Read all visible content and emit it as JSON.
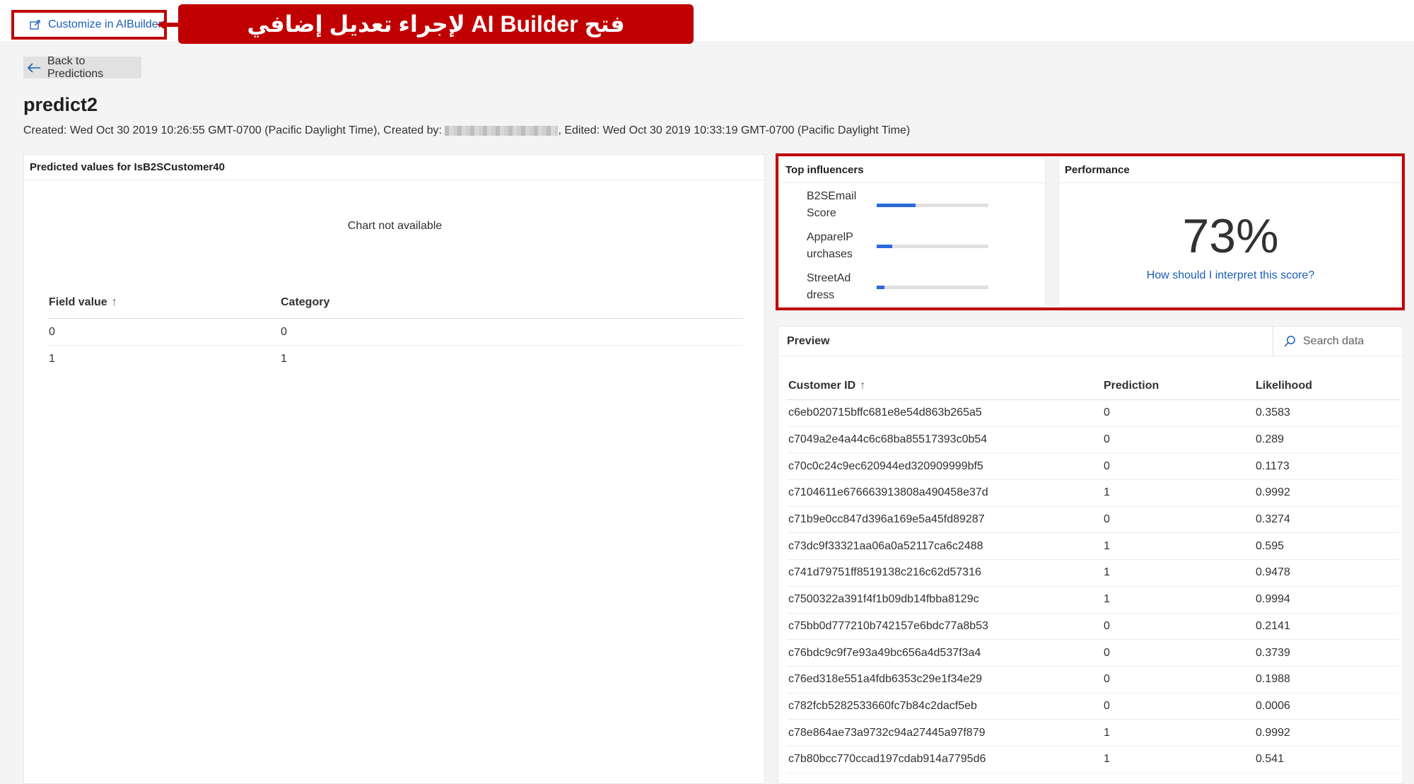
{
  "header": {
    "customize_label": "Customize in AIBuilder",
    "callout_text": "فتح AI Builder لإجراء تعديل إضافي"
  },
  "nav": {
    "back_label": "Back to Predictions"
  },
  "model": {
    "name": "predict2",
    "created": "Created: Wed Oct 30 2019 10:26:55 GMT-0700 (Pacific Daylight Time), Created by: ",
    "edited": ", Edited: Wed Oct 30 2019 10:33:19 GMT-0700 (Pacific Daylight Time)"
  },
  "predicted_values": {
    "title": "Predicted values for IsB2SCustomer40",
    "chart_message": "Chart not available",
    "columns": [
      "Field value",
      "Category"
    ],
    "sort_indicator": "↑",
    "rows": [
      {
        "field_value": "0",
        "category": "0"
      },
      {
        "field_value": "1",
        "category": "1"
      }
    ]
  },
  "top_influencers": {
    "title": "Top influencers",
    "items": [
      {
        "label": "B2SEmail Score",
        "level": 0.35
      },
      {
        "label": "ApparelP urchases",
        "level": 0.14
      },
      {
        "label": "StreetAd dress",
        "level": 0.07
      }
    ]
  },
  "performance": {
    "title": "Performance",
    "value": "73%",
    "link": "How should I interpret this score?"
  },
  "preview": {
    "title": "Preview",
    "search_placeholder": "Search data",
    "columns": [
      "Customer ID",
      "Prediction",
      "Likelihood"
    ],
    "sort_indicator": "↑",
    "rows": [
      {
        "id": "c6eb020715bffc681e8e54d863b265a5",
        "prediction": "0",
        "likelihood": "0.3583"
      },
      {
        "id": "c7049a2e4a44c6c68ba85517393c0b54",
        "prediction": "0",
        "likelihood": "0.289"
      },
      {
        "id": "c70c0c24c9ec620944ed320909999bf5",
        "prediction": "0",
        "likelihood": "0.1173"
      },
      {
        "id": "c7104611e676663913808a490458e37d",
        "prediction": "1",
        "likelihood": "0.9992"
      },
      {
        "id": "c71b9e0cc847d396a169e5a45fd89287",
        "prediction": "0",
        "likelihood": "0.3274"
      },
      {
        "id": "c73dc9f33321aa06a0a52117ca6c2488",
        "prediction": "1",
        "likelihood": "0.595"
      },
      {
        "id": "c741d79751ff8519138c216c62d57316",
        "prediction": "1",
        "likelihood": "0.9478"
      },
      {
        "id": "c7500322a391f4f1b09db14fbba8129c",
        "prediction": "1",
        "likelihood": "0.9994"
      },
      {
        "id": "c75bb0d777210b742157e6bdc77a8b53",
        "prediction": "0",
        "likelihood": "0.2141"
      },
      {
        "id": "c76bdc9c9f7e93a49bc656a4d537f3a4",
        "prediction": "0",
        "likelihood": "0.3739"
      },
      {
        "id": "c76ed318e551a4fdb6353c29e1f34e29",
        "prediction": "0",
        "likelihood": "0.1988"
      },
      {
        "id": "c782fcb5282533660fc7b84c2dacf5eb",
        "prediction": "0",
        "likelihood": "0.0006"
      },
      {
        "id": "c78e864ae73a9732c94a27445a97f879",
        "prediction": "1",
        "likelihood": "0.9992"
      },
      {
        "id": "c7b80bcc770ccad197cdab914a7795d6",
        "prediction": "1",
        "likelihood": "0.541"
      }
    ]
  },
  "colors": {
    "accent": "#1a5fb4",
    "highlight": "#c00000",
    "bar": "#2a6ad9"
  }
}
